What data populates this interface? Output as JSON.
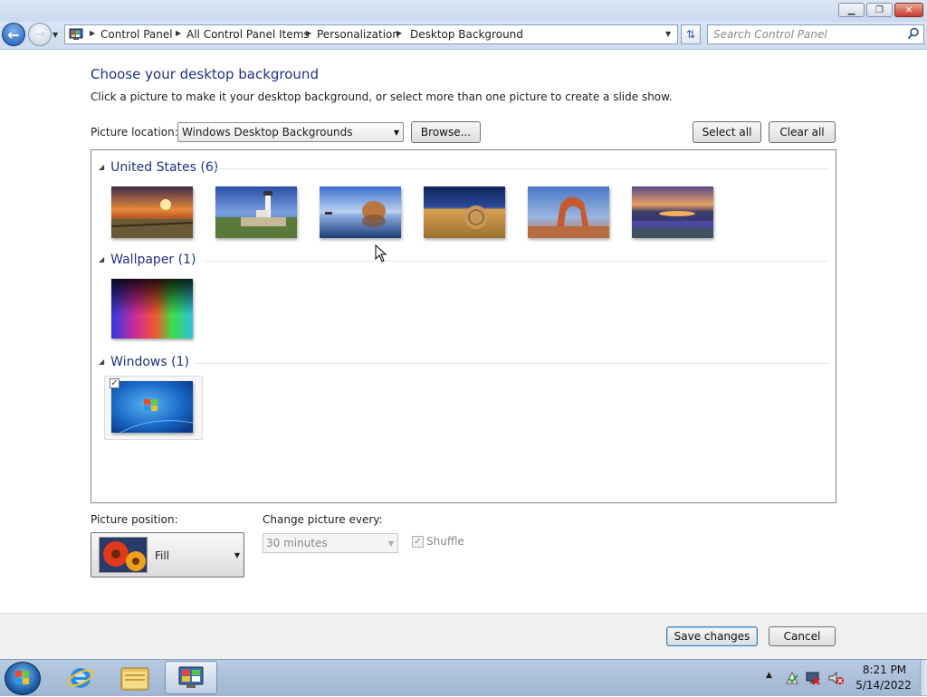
{
  "window": {
    "minimize": "▁",
    "maximize": "❐",
    "close": "✕"
  },
  "nav": {
    "breadcrumb": [
      "Control Panel",
      "All Control Panel Items",
      "Personalization",
      "Desktop Background"
    ],
    "search_placeholder": "Search Control Panel"
  },
  "main": {
    "title": "Choose your desktop background",
    "subtitle": "Click a picture to make it your desktop background, or select more than one picture to create a slide show.",
    "picture_location_label": "Picture location:",
    "picture_location_value": "Windows Desktop Backgrounds",
    "browse_label": "Browse...",
    "select_all_label": "Select all",
    "clear_all_label": "Clear all"
  },
  "groups": [
    {
      "label": "United States (6)",
      "thumbnails": [
        "sunset-barn",
        "lighthouse",
        "rock-in-water",
        "hay-bale",
        "stone-arch",
        "lupine-lake"
      ]
    },
    {
      "label": "Wallpaper (1)",
      "thumbnails": [
        "rainbow-gradient"
      ]
    },
    {
      "label": "Windows (1)",
      "thumbnails": [
        "windows-7-logo"
      ],
      "selected": true
    }
  ],
  "options": {
    "picture_position_label": "Picture position:",
    "picture_position_value": "Fill",
    "change_every_label": "Change picture every:",
    "change_every_value": "30 minutes",
    "shuffle_label": "Shuffle",
    "shuffle_checked": true
  },
  "footer": {
    "save_label": "Save changes",
    "cancel_label": "Cancel"
  },
  "taskbar": {
    "pinned": [
      "internet-explorer-icon",
      "windows-explorer-icon",
      "control-panel-icon"
    ],
    "time": "8:21 PM",
    "date": "5/14/2022"
  },
  "colors": {
    "heading": "#1e3287",
    "accent_border": "#3c7fb1"
  }
}
